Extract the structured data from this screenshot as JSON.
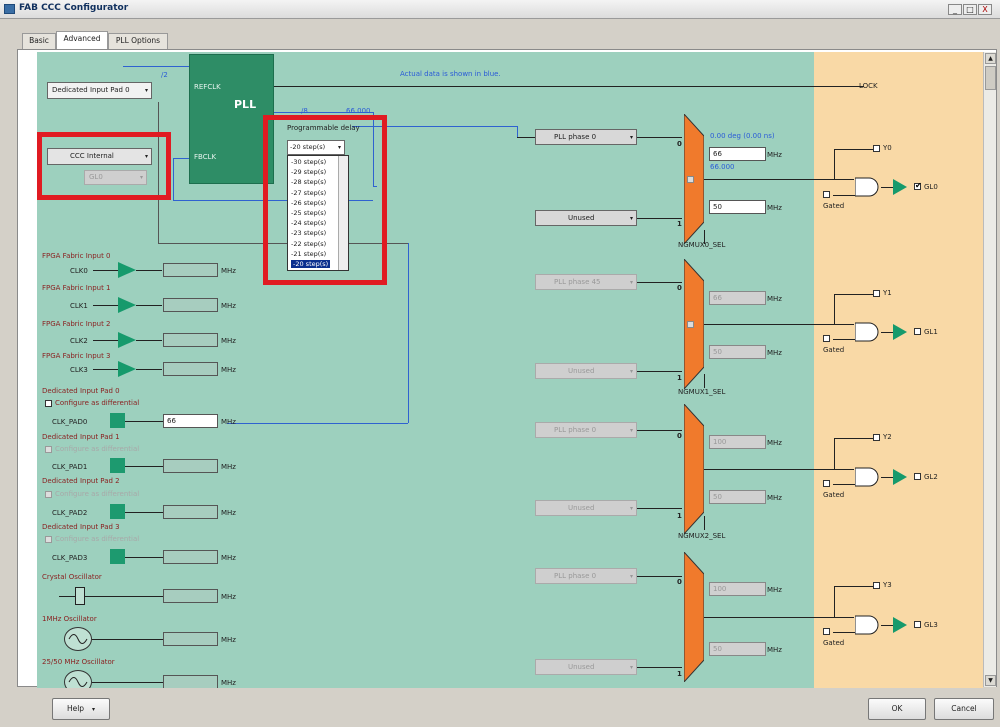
{
  "window": {
    "title": "FAB CCC Configurator",
    "controls": [
      "_",
      "□",
      "X"
    ]
  },
  "tabs": [
    "Basic",
    "Advanced",
    "PLL Options"
  ],
  "active_tab": "Advanced",
  "header_note": "Actual data is shown in blue.",
  "ref_input": {
    "value": "Dedicated Input Pad 0"
  },
  "div2": "/2",
  "pll": {
    "title": "PLL",
    "refclk": "REFCLK",
    "fbclk": "FBCLK",
    "div8": "/8",
    "freq": "66.000",
    "lock": "LOCK",
    "div1": "/1"
  },
  "ccc_internal": {
    "value": "CCC Internal",
    "sub": "GL0"
  },
  "prog_delay": {
    "label": "Programmable delay",
    "selected": "-20 step(s)",
    "options": [
      "-30 step(s)",
      "-29 step(s)",
      "-28 step(s)",
      "-27 step(s)",
      "-26 step(s)",
      "-25 step(s)",
      "-24 step(s)",
      "-23 step(s)",
      "-22 step(s)",
      "-21 step(s)",
      "-20 step(s)"
    ]
  },
  "fabric_inputs": [
    {
      "title": "FPGA Fabric Input 0",
      "clk": "CLK0",
      "unit": "MHz"
    },
    {
      "title": "FPGA Fabric Input 1",
      "clk": "CLK1",
      "unit": "MHz"
    },
    {
      "title": "FPGA Fabric Input 2",
      "clk": "CLK2",
      "unit": "MHz"
    },
    {
      "title": "FPGA Fabric Input 3",
      "clk": "CLK3",
      "unit": "MHz"
    }
  ],
  "pads": [
    {
      "title": "Dedicated Input Pad 0",
      "diff": "Configure as differential",
      "clk": "CLK_PAD0",
      "value": "66",
      "unit": "MHz"
    },
    {
      "title": "Dedicated Input Pad 1",
      "diff": "Configure as differential",
      "clk": "CLK_PAD1",
      "value": "",
      "unit": "MHz"
    },
    {
      "title": "Dedicated Input Pad 2",
      "diff": "Configure as differential",
      "clk": "CLK_PAD2",
      "value": "",
      "unit": "MHz"
    },
    {
      "title": "Dedicated Input Pad 3",
      "diff": "Configure as differential",
      "clk": "CLK_PAD3",
      "value": "",
      "unit": "MHz"
    }
  ],
  "oscillators": [
    {
      "title": "Crystal Oscillator",
      "unit": "MHz"
    },
    {
      "title": "1MHz Oscillator",
      "unit": "MHz"
    },
    {
      "title": "25/50 MHz Oscillator",
      "unit": "MHz"
    }
  ],
  "outputs": [
    {
      "phase": "PLL phase 0",
      "unused": "Unused",
      "freq1": "66",
      "freq2": "50",
      "unit": "MHz",
      "sel": "NGMUX0_SEL",
      "y": "Y0",
      "gl": "GL0",
      "gated": "Gated",
      "deg": "0.00 deg (0.00 ns)",
      "actual": "66.000",
      "mux_top": "0",
      "mux_bot": "1"
    },
    {
      "phase": "PLL phase 45",
      "unused": "Unused",
      "freq1": "66",
      "freq2": "50",
      "unit": "MHz",
      "sel": "NGMUX1_SEL",
      "y": "Y1",
      "gl": "GL1",
      "gated": "Gated",
      "mux_top": "0",
      "mux_bot": "1"
    },
    {
      "phase": "PLL phase 0",
      "unused": "Unused",
      "freq1": "100",
      "freq2": "50",
      "unit": "MHz",
      "sel": "NGMUX2_SEL",
      "y": "Y2",
      "gl": "GL2",
      "gated": "Gated",
      "mux_top": "0",
      "mux_bot": "1"
    },
    {
      "phase": "PLL phase 0",
      "unused": "Unused",
      "freq1": "100",
      "freq2": "50",
      "unit": "MHz",
      "y": "Y3",
      "gl": "GL3",
      "gated": "Gated",
      "mux_top": "0",
      "mux_bot": "1"
    }
  ],
  "bottom": {
    "help": "Help",
    "ok": "OK",
    "cancel": "Cancel"
  },
  "colors": {
    "canvas": "#9dd0be",
    "right_band": "#f9d9a6",
    "pll": "#2e8d66",
    "highlight": "#e01b22",
    "mux": "#f07a2c",
    "buffer": "#169a6c"
  }
}
